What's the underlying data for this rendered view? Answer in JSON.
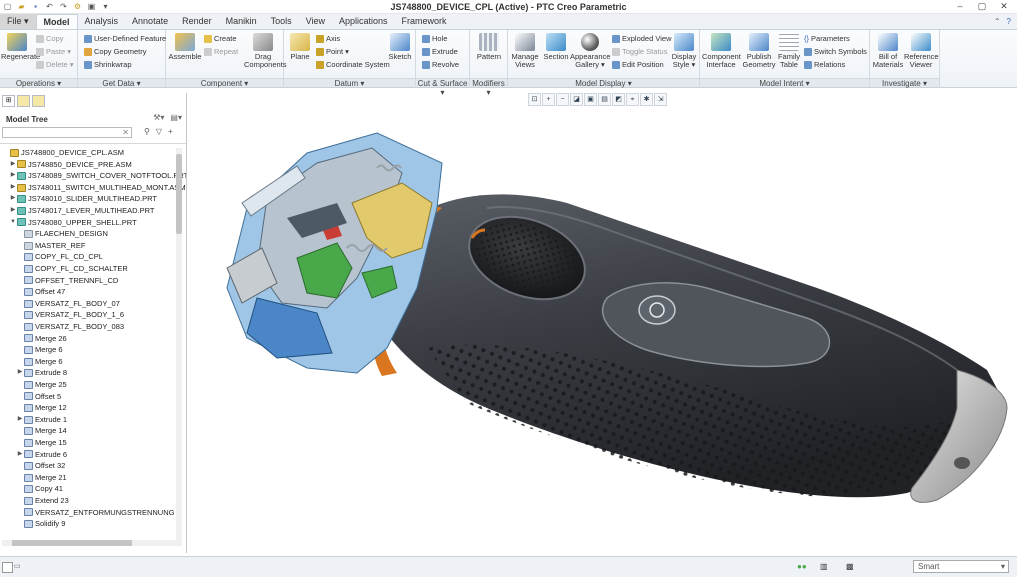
{
  "window": {
    "title": "JS748800_DEVICE_CPL (Active) - PTC Creo Parametric",
    "controls": [
      "–",
      "▢",
      "✕"
    ]
  },
  "quick_access": [
    "new-icon",
    "open-icon",
    "save-icon",
    "undo-icon",
    "redo-icon",
    "regenerate-icon",
    "window-icon",
    "close-icon"
  ],
  "tabs": [
    "File ▾",
    "Model",
    "Analysis",
    "Annotate",
    "Render",
    "Manikin",
    "Tools",
    "View",
    "Applications",
    "Framework"
  ],
  "active_tab": "Model",
  "ribbon": {
    "operations": {
      "label": "Operations ▾",
      "regenerate": "Regenerate",
      "copy": "Copy",
      "paste": "Paste ▾",
      "delete": "Delete ▾"
    },
    "get_data": {
      "label": "Get Data ▾",
      "udf": "User-Defined Feature",
      "copy_geometry": "Copy Geometry",
      "shrinkwrap": "Shrinkwrap"
    },
    "component": {
      "label": "Component ▾",
      "assemble": "Assemble",
      "create": "Create",
      "repeat": "Repeat",
      "drag": "Drag Components"
    },
    "datum": {
      "label": "Datum ▾",
      "plane": "Plane",
      "axis": "Axis",
      "point": "Point ▾",
      "csys": "Coordinate System",
      "sketch": "Sketch"
    },
    "cut_surface": {
      "label": "Cut & Surface ▾",
      "hole": "Hole",
      "extrude": "Extrude",
      "revolve": "Revolve"
    },
    "modifiers": {
      "label": "Modifiers ▾",
      "pattern": "Pattern"
    },
    "model_display": {
      "label": "Model Display ▾",
      "manage_views": "Manage Views",
      "section": "Section",
      "appearance": "Appearance Gallery ▾",
      "exploded": "Exploded View",
      "toggle_status": "Toggle Status",
      "edit_position": "Edit Position",
      "display_style": "Display Style ▾"
    },
    "model_intent": {
      "label": "Model Intent ▾",
      "component_interface": "Component Interface",
      "publish_geometry": "Publish Geometry",
      "family_table": "Family Table",
      "parameters": "Parameters",
      "switch_symbols": "Switch Symbols",
      "relations": "Relations"
    },
    "investigate": {
      "label": "Investigate ▾",
      "bom": "Bill of Materials",
      "reference_viewer": "Reference Viewer"
    }
  },
  "model_tree": {
    "title": "Model Tree",
    "search_value": "",
    "items": [
      {
        "label": "JS748800_DEVICE_CPL.ASM",
        "type": "asm",
        "toggle": "",
        "indent": 0
      },
      {
        "label": "JS748850_DEVICE_PRE.ASM",
        "type": "asm",
        "toggle": "▶",
        "indent": 1
      },
      {
        "label": "JS748089_SWITCH_COVER_NOTFTOOL.PRT",
        "type": "prt",
        "toggle": "▶",
        "indent": 1
      },
      {
        "label": "JS748011_SWITCH_MULTIHEAD_MONT.ASM",
        "type": "asm",
        "toggle": "▶",
        "indent": 1
      },
      {
        "label": "JS748010_SLIDER_MULTIHEAD.PRT",
        "type": "prt",
        "toggle": "▶",
        "indent": 1
      },
      {
        "label": "JS748017_LEVER_MULTIHEAD.PRT",
        "type": "prt",
        "toggle": "▶",
        "indent": 1
      },
      {
        "label": "JS748080_UPPER_SHELL.PRT",
        "type": "prt",
        "toggle": "▼",
        "indent": 1
      },
      {
        "label": "FLAECHEN_DESIGN",
        "type": "dtm",
        "toggle": "",
        "indent": 2
      },
      {
        "label": "MASTER_REF",
        "type": "dtm",
        "toggle": "",
        "indent": 2
      },
      {
        "label": "COPY_FL_CD_CPL",
        "type": "feat",
        "toggle": "",
        "indent": 2
      },
      {
        "label": "COPY_FL_CD_SCHALTER",
        "type": "feat",
        "toggle": "",
        "indent": 2
      },
      {
        "label": "OFFSET_TRENNFL_CD",
        "type": "feat",
        "toggle": "",
        "indent": 2
      },
      {
        "label": "Offset 47",
        "type": "feat",
        "toggle": "",
        "indent": 2
      },
      {
        "label": "VERSATZ_FL_BODY_07",
        "type": "feat",
        "toggle": "",
        "indent": 2
      },
      {
        "label": "VERSATZ_FL_BODY_1_6",
        "type": "feat",
        "toggle": "",
        "indent": 2
      },
      {
        "label": "VERSATZ_FL_BODY_083",
        "type": "feat",
        "toggle": "",
        "indent": 2
      },
      {
        "label": "Merge 26",
        "type": "feat",
        "toggle": "",
        "indent": 2
      },
      {
        "label": "Merge 6",
        "type": "feat",
        "toggle": "",
        "indent": 2
      },
      {
        "label": "Merge 6",
        "type": "feat",
        "toggle": "",
        "indent": 2
      },
      {
        "label": "Extrude 8",
        "type": "feat",
        "toggle": "▶",
        "indent": 2
      },
      {
        "label": "Merge 25",
        "type": "feat",
        "toggle": "",
        "indent": 2
      },
      {
        "label": "Offset 5",
        "type": "feat",
        "toggle": "",
        "indent": 2
      },
      {
        "label": "Merge 12",
        "type": "feat",
        "toggle": "",
        "indent": 2
      },
      {
        "label": "Extrude 1",
        "type": "feat",
        "toggle": "▶",
        "indent": 2
      },
      {
        "label": "Merge 14",
        "type": "feat",
        "toggle": "",
        "indent": 2
      },
      {
        "label": "Merge 15",
        "type": "feat",
        "toggle": "",
        "indent": 2
      },
      {
        "label": "Extrude 6",
        "type": "feat",
        "toggle": "▶",
        "indent": 2
      },
      {
        "label": "Offset 32",
        "type": "feat",
        "toggle": "",
        "indent": 2
      },
      {
        "label": "Merge 21",
        "type": "feat",
        "toggle": "",
        "indent": 2
      },
      {
        "label": "Copy 41",
        "type": "feat",
        "toggle": "",
        "indent": 2
      },
      {
        "label": "Extend 23",
        "type": "feat",
        "toggle": "",
        "indent": 2
      },
      {
        "label": "VERSATZ_ENTFORMUNGSTRENNUNG",
        "type": "feat",
        "toggle": "",
        "indent": 2
      },
      {
        "label": "Solidify 9",
        "type": "feat",
        "toggle": "",
        "indent": 2
      }
    ]
  },
  "status_bar": {
    "filter_label": "Smart"
  },
  "colors": {
    "shell": "#3b3e44",
    "accent_orange": "#d9761f",
    "cut_blue": "#9fc6e6",
    "green_part": "#48a84a",
    "yellow_part": "#e2c96b"
  }
}
